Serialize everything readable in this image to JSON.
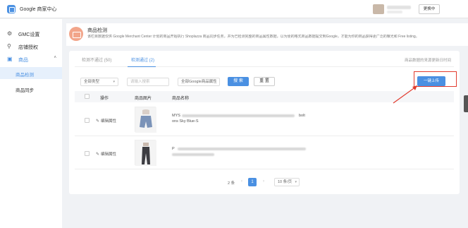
{
  "topbar": {
    "app_title": "Google 商家中心",
    "switch_label": "更换中"
  },
  "sidebar": {
    "items": [
      {
        "label": "GMC设置",
        "icon": "gear-icon"
      },
      {
        "label": "店铺授权",
        "icon": "link-icon"
      },
      {
        "label": "商品",
        "icon": "bag-icon"
      }
    ],
    "sub_items": [
      {
        "label": "商品检测"
      },
      {
        "label": "商品同步"
      }
    ]
  },
  "header": {
    "title": "商品检测",
    "description": "该栏目数据仅供 Google Merchant Center 计划的商品开始执行 Shoplazza 商品同步任务，并为已检测完整的商品属性数据，以为便的格式商品数据提交到Google，才能为你的商品获得更广泛的曝光和 Free listing。"
  },
  "tabs": [
    {
      "label": "检测不通过 (50)"
    },
    {
      "label": "检测通过 (2)"
    }
  ],
  "right_note": "商品数据的来源更新日时间",
  "filters": {
    "type_value": "全部类型",
    "keyword_placeholder": "请输入搜索",
    "attribute_value": "全部Google商品属性"
  },
  "buttons": {
    "search": "搜 索",
    "reset": "重 置",
    "one_click_upload": "一键上传"
  },
  "table": {
    "headers": [
      "操作",
      "商品图片",
      "商品名称"
    ],
    "rows": [
      {
        "action": "编辑属性",
        "name_prefix": "MYS",
        "name_suffix": "bolt",
        "name_line2": "ons Sky Blue-S"
      },
      {
        "action": "编辑属性",
        "name_prefix": "P",
        "name_line2": ""
      }
    ]
  },
  "pagination": {
    "total": "2 条",
    "current_page": "1",
    "page_size": "10 条/页"
  }
}
